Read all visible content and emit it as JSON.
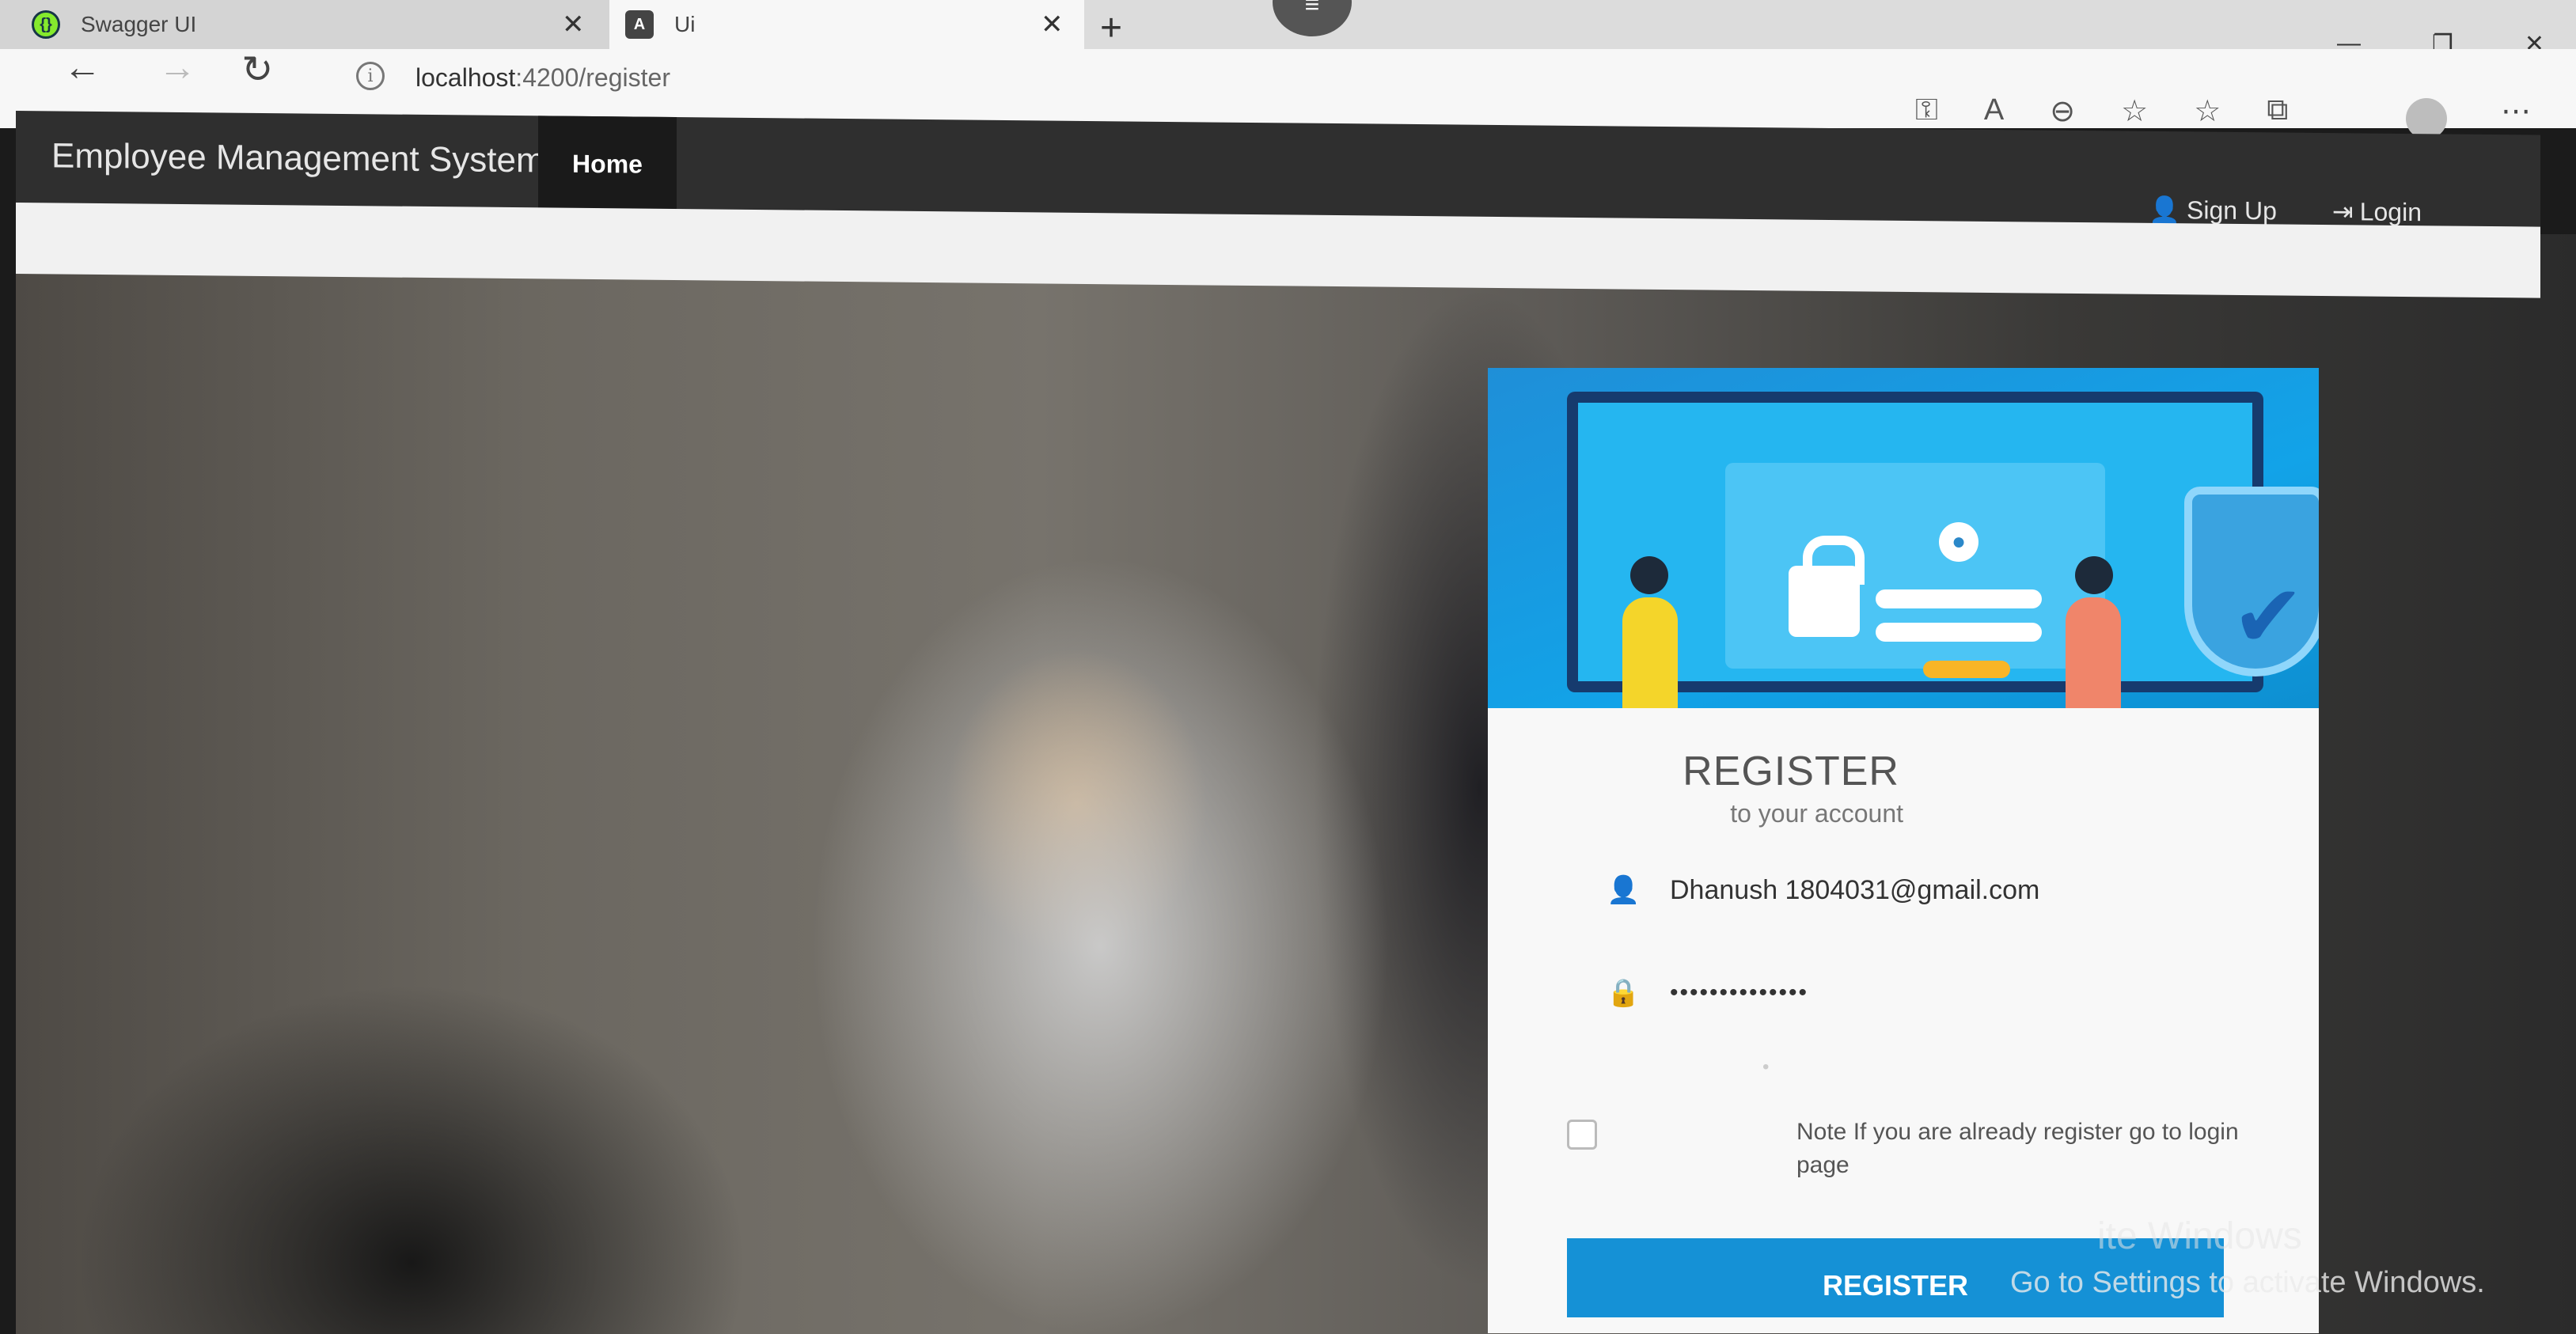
{
  "browser": {
    "tabs": [
      {
        "title": "Swagger UI",
        "favicon": "swagger-icon"
      },
      {
        "title": "Ui",
        "favicon": "angular-icon"
      }
    ],
    "url_host": "localhost",
    "url_path": ":4200/register"
  },
  "navbar": {
    "brand": "Employee Management System",
    "home": "Home",
    "signup": "Sign Up",
    "login": "Login"
  },
  "register": {
    "title": "REGISTER",
    "subtitle": "to your account",
    "email": "Dhanush 1804031@gmail.com",
    "password": "••••••••••••••",
    "note": "Note If you are already register go to login page",
    "button": "REGISTER"
  },
  "watermark": {
    "line1": "ite Windows",
    "line2": "Go to Settings to activate Windows."
  },
  "colors": {
    "navbar": "#2f2f2f",
    "accent": "#1591d6",
    "illustration": "#12a3e8"
  }
}
